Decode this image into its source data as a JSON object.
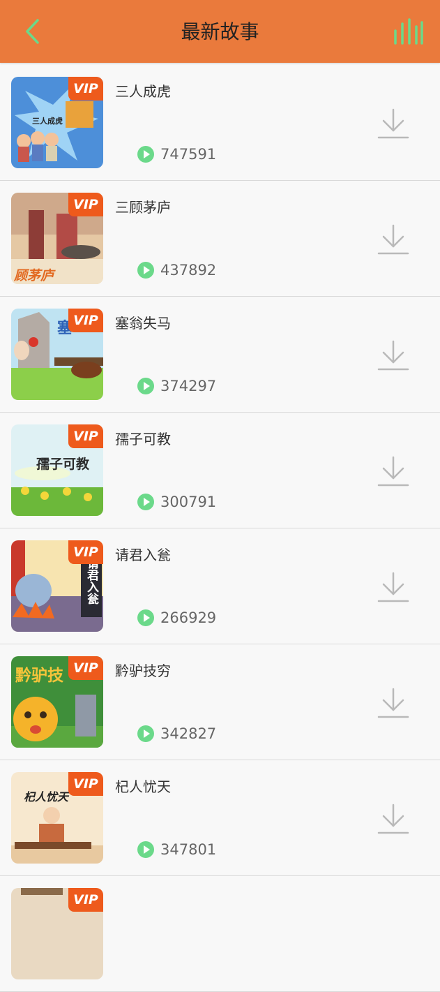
{
  "header": {
    "title": "最新故事",
    "back_icon": "chevron-left-icon",
    "stats_icon": "bar-chart-icon"
  },
  "colors": {
    "header_bg": "#ea7a3c",
    "icon_green": "#6bd98a",
    "vip_bg": "#ee5a1c"
  },
  "vip_label": "VIP",
  "stories": [
    {
      "title": "三人成虎",
      "plays": "747591",
      "thumb_text": "三人成虎"
    },
    {
      "title": "三顾茅庐",
      "plays": "437892",
      "thumb_text": "顾茅庐"
    },
    {
      "title": "塞翁失马",
      "plays": "374297",
      "thumb_text": "塞"
    },
    {
      "title": "孺子可教",
      "plays": "300791",
      "thumb_text": "孺子可教"
    },
    {
      "title": "请君入瓮",
      "plays": "266929",
      "thumb_text": "请君入瓮"
    },
    {
      "title": "黔驴技穷",
      "plays": "342827",
      "thumb_text": "黔驴技"
    },
    {
      "title": "杞人忧天",
      "plays": "347801",
      "thumb_text": "杞人忧天"
    }
  ]
}
